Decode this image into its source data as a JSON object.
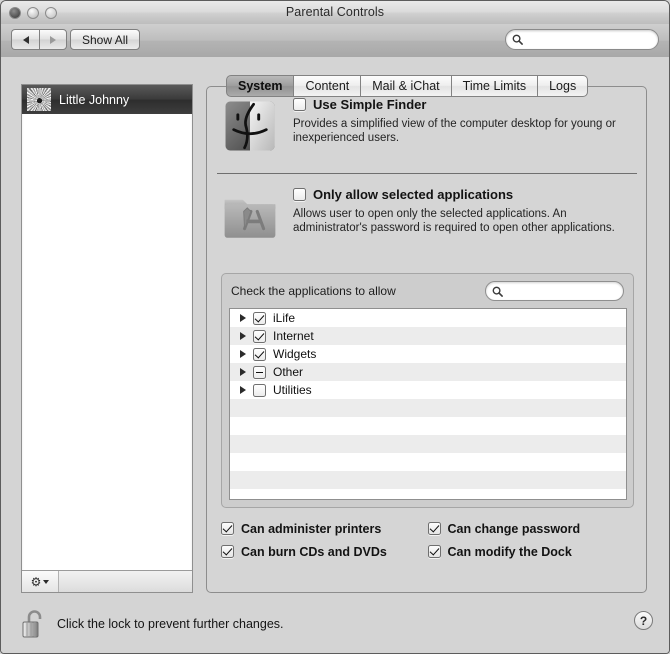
{
  "window": {
    "title": "Parental Controls",
    "traffic_lights": [
      "close",
      "minimize",
      "zoom"
    ]
  },
  "toolbar": {
    "back_label": "◀",
    "forward_label": "▶",
    "show_all_label": "Show All",
    "search": {
      "value": "",
      "placeholder": "",
      "icon": "search-icon"
    }
  },
  "sidebar": {
    "users": [
      {
        "name": "Little Johnny",
        "selected": true,
        "avatar": "flower-photo-avatar"
      }
    ],
    "footer": {
      "gear_label": "⚙",
      "menu_indicator": "chevron-down-icon"
    }
  },
  "tabs": [
    {
      "label": "System",
      "active": true
    },
    {
      "label": "Content",
      "active": false
    },
    {
      "label": "Mail & iChat",
      "active": false
    },
    {
      "label": "Time Limits",
      "active": false
    },
    {
      "label": "Logs",
      "active": false
    }
  ],
  "system_pane": {
    "simple_finder": {
      "icon": "finder-face-icon",
      "checkbox_label": "Use Simple Finder",
      "checked": false,
      "description": "Provides a simplified view of the computer desktop for young or inexperienced users."
    },
    "only_allow_apps": {
      "icon": "applications-folder-icon",
      "checkbox_label": "Only allow selected applications",
      "checked": false,
      "description": "Allows user to open only the selected applications. An administrator's password is required to open other applications."
    },
    "apps_group": {
      "label": "Check the applications to allow",
      "search": {
        "value": "",
        "placeholder": "",
        "icon": "search-icon"
      },
      "rows": [
        {
          "name": "iLife",
          "state": "checked",
          "expandable": true
        },
        {
          "name": "Internet",
          "state": "checked",
          "expandable": true
        },
        {
          "name": "Widgets",
          "state": "checked",
          "expandable": true
        },
        {
          "name": "Other",
          "state": "mixed",
          "expandable": true
        },
        {
          "name": "Utilities",
          "state": "unchecked",
          "expandable": true
        }
      ],
      "empty_rows": 6
    },
    "permissions": [
      {
        "label": "Can administer printers",
        "checked": true
      },
      {
        "label": "Can change password",
        "checked": true
      },
      {
        "label": "Can burn CDs and DVDs",
        "checked": true
      },
      {
        "label": "Can modify the Dock",
        "checked": true
      }
    ]
  },
  "lock_bar": {
    "icon": "unlocked-padlock-icon",
    "text": "Click the lock to prevent further changes.",
    "help_label": "?"
  },
  "colors": {
    "window_bg": "#d4d4d4",
    "panel_bg": "#d5d5d5",
    "list_bg": "#ffffff",
    "list_alt_row": "#ececec",
    "selected_row": "#3a3a3a",
    "border": "#8d8d8d",
    "text": "#131313"
  }
}
